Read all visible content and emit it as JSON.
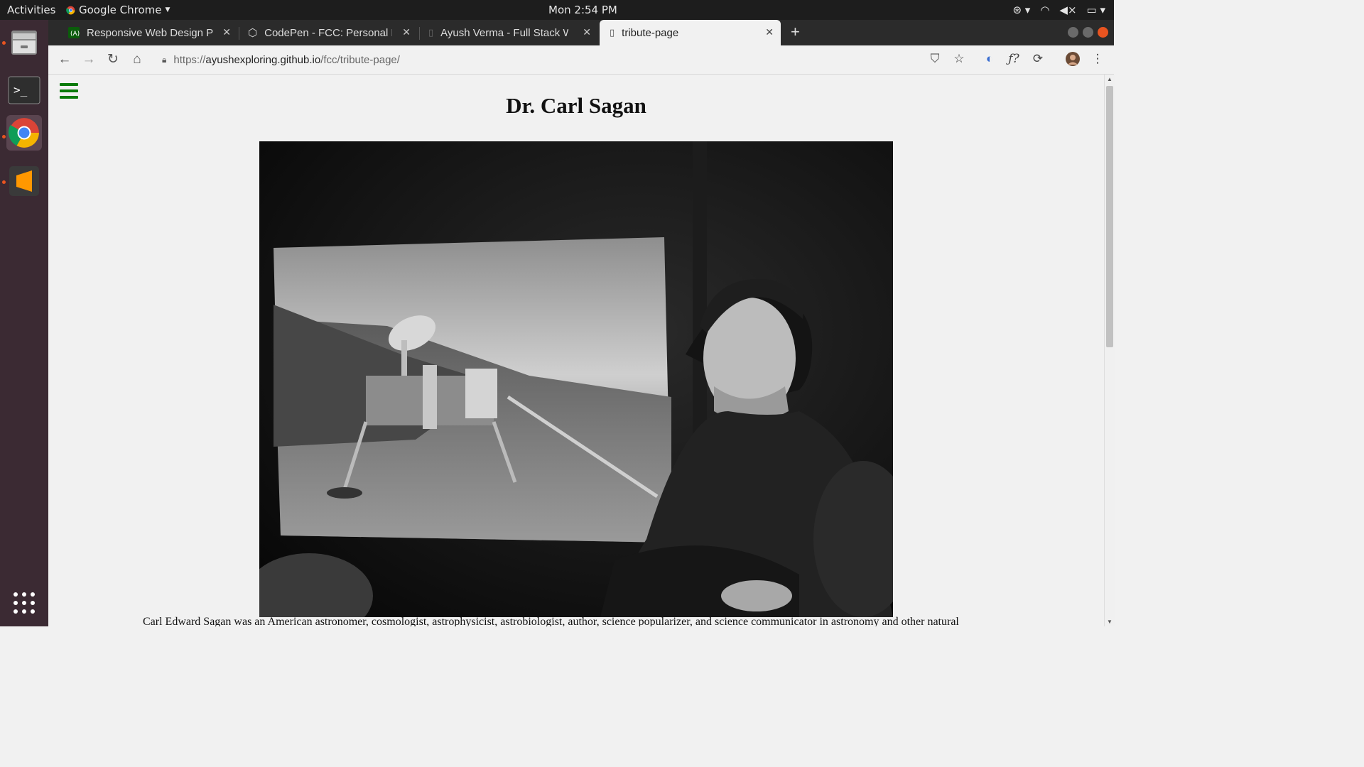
{
  "desktop": {
    "activities": "Activities",
    "app_name": "Google Chrome",
    "clock": "Mon  2:54 PM"
  },
  "browser": {
    "tabs": [
      {
        "title": "Responsive Web Design P"
      },
      {
        "title": "CodePen - FCC: Personal F"
      },
      {
        "title": "Ayush Verma - Full Stack W"
      },
      {
        "title": "tribute-page"
      }
    ],
    "url": {
      "scheme": "https://",
      "host": "ayushexploring.github.io",
      "path": "/fcc/tribute-page/"
    }
  },
  "page": {
    "title": "Dr. Carl Sagan",
    "bio_line": "Carl Edward Sagan was an American astronomer, cosmologist, astrophysicist, astrobiologist, author, science popularizer, and science communicator in astronomy and other natural"
  },
  "colors": {
    "accent_green": "#0a7a0a",
    "ubuntu_orange": "#e95420"
  }
}
